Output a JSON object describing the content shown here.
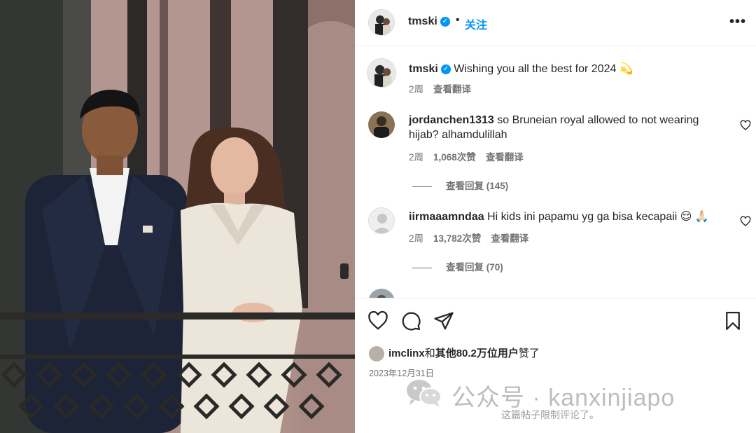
{
  "header": {
    "username": "tmski",
    "separator": "•",
    "follow_label": "关注",
    "more_label": "•••"
  },
  "caption": {
    "username": "tmski",
    "text": "Wishing you all the best for 2024 💫",
    "time": "2周",
    "translate": "查看翻译"
  },
  "comments": [
    {
      "username": "jordanchen1313",
      "text": "so Bruneian royal allowed to not wearing hijab? alhamdulillah",
      "time": "2周",
      "likes": "1,068次赞",
      "translate": "查看翻译",
      "replies": "查看回复 (145)"
    },
    {
      "username": "iirmaaamndaa",
      "text": "Hi kids ini papamu yg ga bisa kecapaii 😌 🙏🏻",
      "time": "2周",
      "likes": "13,782次赞",
      "translate": "查看翻译",
      "replies": "查看回复 (70)"
    }
  ],
  "likes_summary": {
    "user": "imclinx",
    "joiner": "和",
    "others": "其他80.2万位用户",
    "suffix": "赞了"
  },
  "date": "2023年12月31日",
  "watermark": {
    "text": "公众号 · kanxinjiapo"
  },
  "comments_closed": "这篇帖子限制评论了。",
  "colors": {
    "accent_blue": "#0095f6",
    "text_primary": "#262626",
    "text_secondary": "#737373"
  },
  "icons": [
    "verified-icon",
    "heart-icon",
    "comment-icon",
    "share-icon",
    "bookmark-icon",
    "more-icon"
  ]
}
